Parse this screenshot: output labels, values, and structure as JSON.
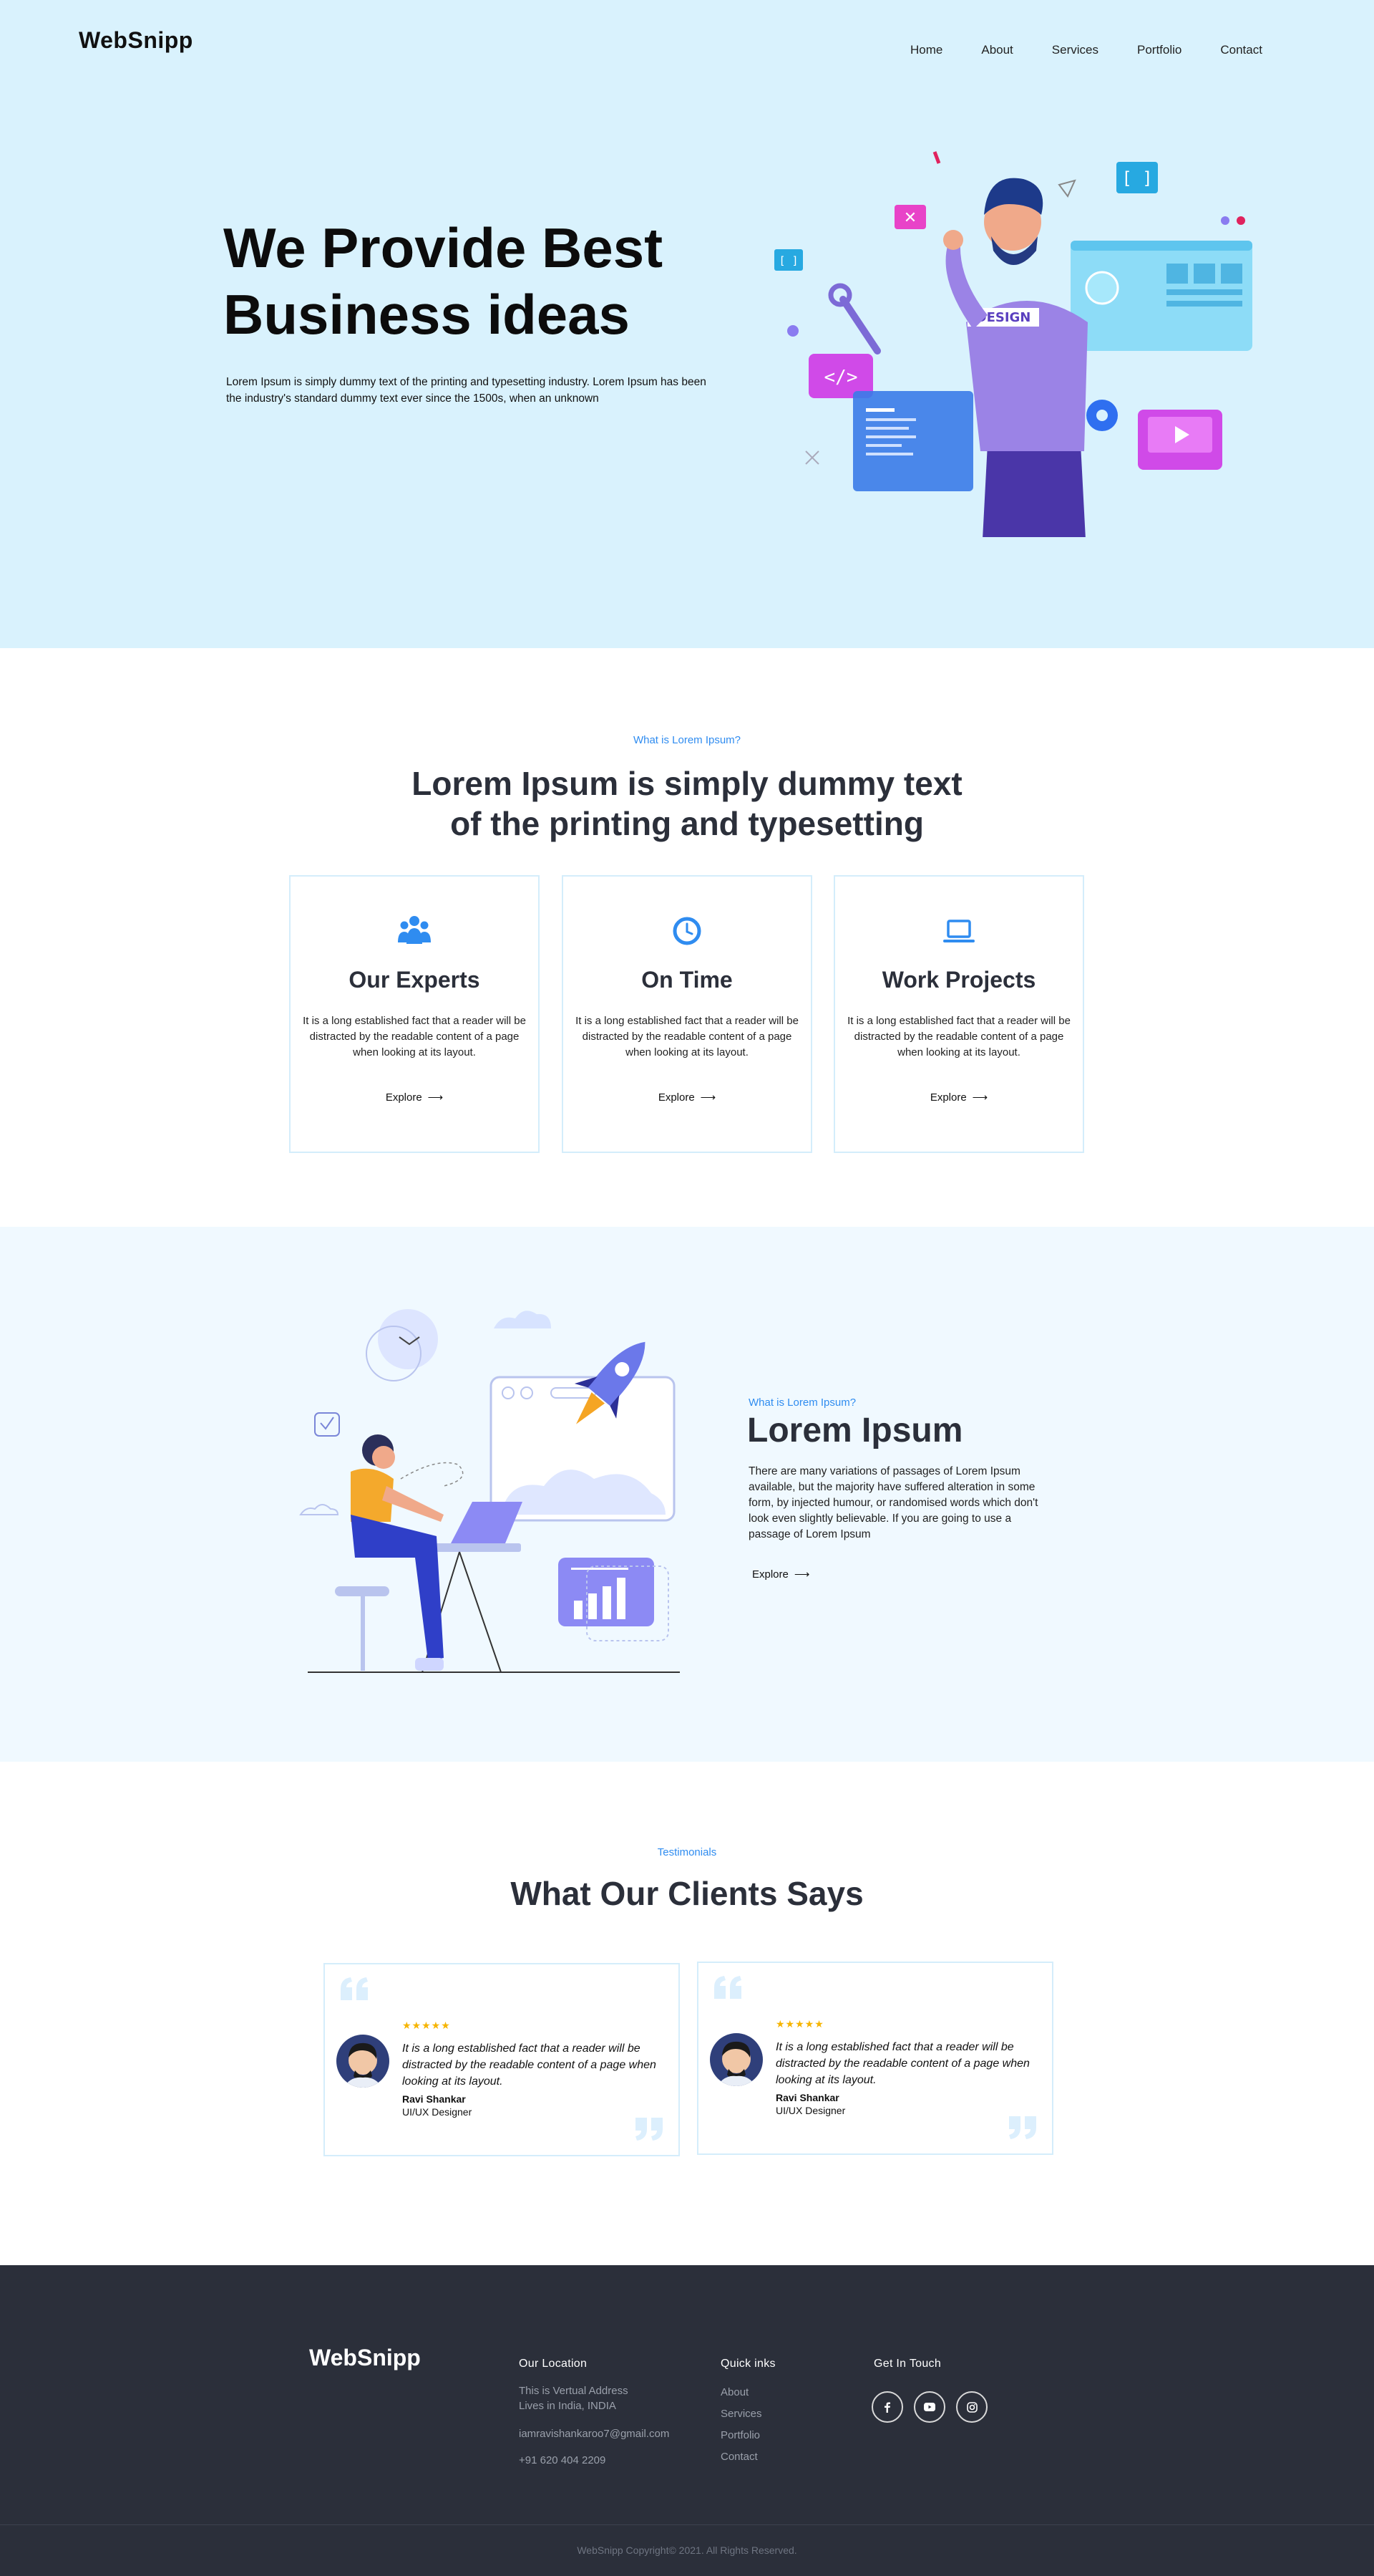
{
  "header": {
    "logo": "WebSnipp",
    "nav": [
      "Home",
      "About",
      "Services",
      "Portfolio",
      "Contact"
    ]
  },
  "hero": {
    "title_line1": "We Provide Best",
    "title_line2": "Business ideas",
    "subtitle": "Lorem Ipsum is simply dummy text of the printing and typesetting industry. Lorem Ipsum has been the industry's standard dummy text ever since the 1500s, when an unknown",
    "illustration_badge": "DESIGN"
  },
  "features": {
    "eyebrow": "What is Lorem Ipsum?",
    "title_line1": "Lorem Ipsum is simply dummy text",
    "title_line2": "of the printing and typesetting",
    "cards": [
      {
        "icon": "users-icon",
        "title": "Our Experts",
        "text": "It is a long established fact that a reader will be distracted by the readable content of a page when looking at its layout.",
        "link": "Explore"
      },
      {
        "icon": "clock-icon",
        "title": "On Time",
        "text": "It is a long established fact that a reader will be distracted by the readable content of a page when looking at its layout.",
        "link": "Explore"
      },
      {
        "icon": "laptop-icon",
        "title": "Work Projects",
        "text": "It is a long established fact that a reader will be distracted by the readable content of a page when looking at its layout.",
        "link": "Explore"
      }
    ]
  },
  "about": {
    "eyebrow": "What is Lorem Ipsum?",
    "title": "Lorem Ipsum",
    "text": "There are many variations of passages of Lorem Ipsum available, but the majority have suffered alteration in some form, by injected humour, or randomised words which don't look even slightly believable. If you are going to use a passage of Lorem Ipsum",
    "link": "Explore"
  },
  "testimonials": {
    "eyebrow": "Testimonials",
    "title": "What Our Clients Says",
    "items": [
      {
        "stars": "★★★★★",
        "rating": 5,
        "quote": "It is a long established fact that a reader will be distracted by the readable content of a page when looking at its layout.",
        "name": "Ravi Shankar",
        "role": "UI/UX Designer"
      },
      {
        "stars": "★★★★★",
        "rating": 5,
        "quote": "It is a long established fact that a reader will be distracted by the readable content of a page when looking at its layout.",
        "name": "Ravi Shankar",
        "role": "UI/UX Designer"
      }
    ]
  },
  "footer": {
    "logo": "WebSnipp",
    "location_heading": "Our Location",
    "address_line1": "This is Vertual Address",
    "address_line2": "Lives in India,  INDIA",
    "email": "iamravishankaroo7@gmail.com",
    "phone": "+91 620 404 2209",
    "quick_heading": "Quick inks",
    "quick_links": [
      "About",
      "Services",
      "Portfolio",
      "Contact"
    ],
    "touch_heading": "Get In Touch",
    "social": [
      "facebook-icon",
      "youtube-icon",
      "instagram-icon"
    ],
    "copyright": "WebSnipp Copyright© 2021. All Rights Reserved."
  },
  "colors": {
    "hero_bg": "#d9f2fd",
    "accent": "#2f8cf0",
    "heading": "#2b2f3a",
    "footer_bg": "#2b2f3a",
    "star": "#f6b400"
  }
}
